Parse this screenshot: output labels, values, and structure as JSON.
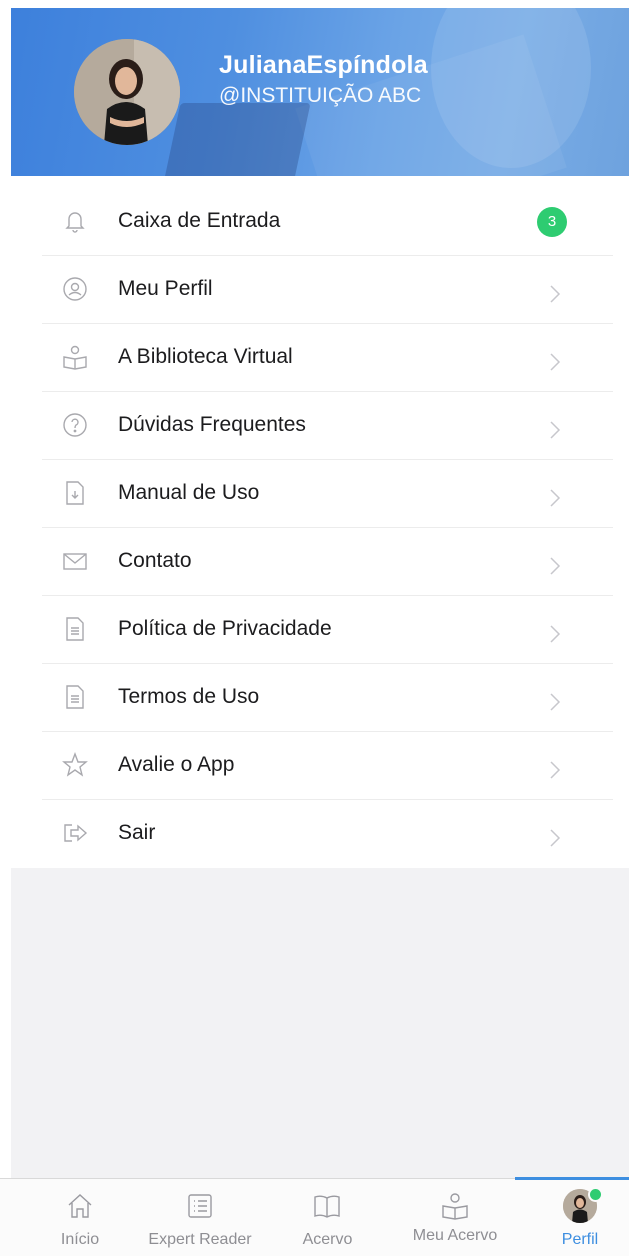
{
  "profile": {
    "name": "JulianaEspíndola",
    "handle": "@INSTITUIÇÃO ABC"
  },
  "menu": {
    "items": [
      {
        "label": "Caixa de Entrada",
        "icon": "bell-icon",
        "badge": "3"
      },
      {
        "label": "Meu Perfil",
        "icon": "user-circle-icon"
      },
      {
        "label": "A Biblioteca Virtual",
        "icon": "reader-book-icon"
      },
      {
        "label": "Dúvidas Frequentes",
        "icon": "question-circle-icon"
      },
      {
        "label": "Manual de Uso",
        "icon": "document-download-icon"
      },
      {
        "label": "Contato",
        "icon": "envelope-icon"
      },
      {
        "label": "Política de Privacidade",
        "icon": "document-icon"
      },
      {
        "label": "Termos de Uso",
        "icon": "document-icon"
      },
      {
        "label": "Avalie o App",
        "icon": "star-icon"
      },
      {
        "label": "Sair",
        "icon": "logout-icon"
      }
    ]
  },
  "tabbar": {
    "tabs": [
      {
        "label": "Início",
        "icon": "home-icon"
      },
      {
        "label": "Expert Reader",
        "icon": "list-icon"
      },
      {
        "label": "Acervo",
        "icon": "open-book-icon"
      },
      {
        "label": "Meu Acervo",
        "icon": "reader-book-icon"
      },
      {
        "label": "Perfil",
        "icon": "avatar",
        "active": true
      }
    ]
  },
  "colors": {
    "accent": "#3d8ee0",
    "badge": "#2ecc71",
    "header_start": "#3d80dc",
    "header_end": "#78ace6",
    "icon_gray": "#a9a9ae"
  }
}
